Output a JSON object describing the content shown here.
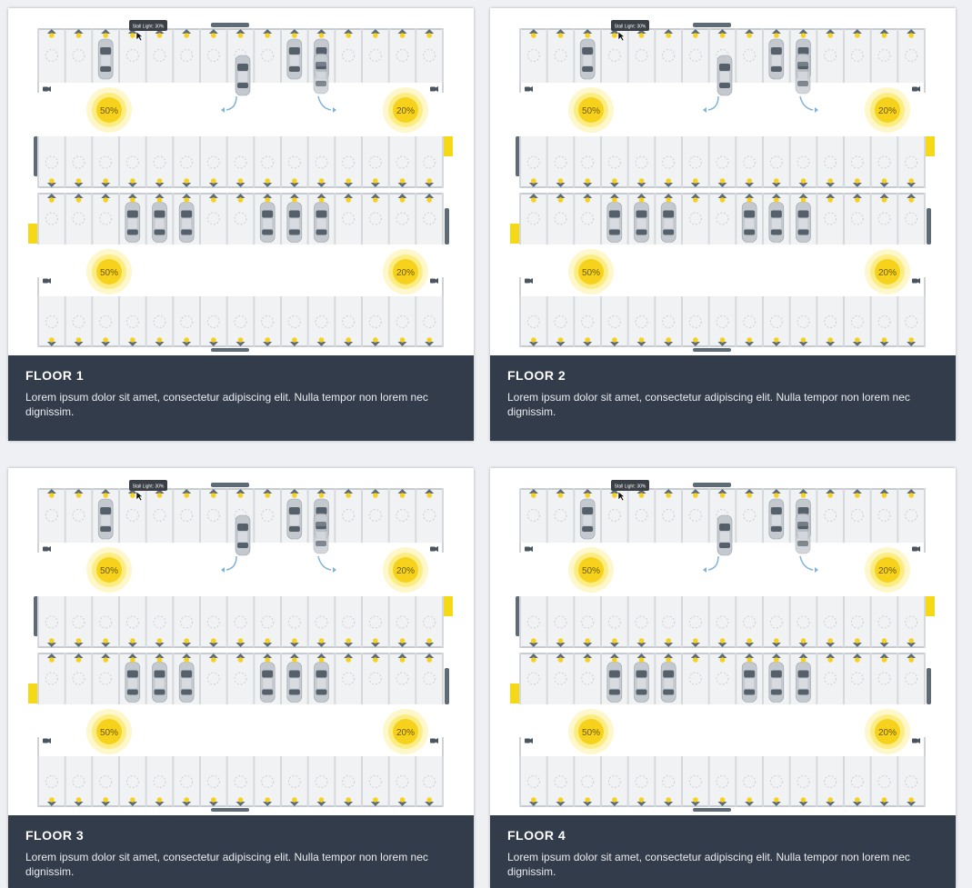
{
  "floors": [
    {
      "title": "FLOOR 1",
      "description": "Lorem ipsum dolor sit amet, consectetur adipiscing elit. Nulla tempor non lorem nec dignissim.",
      "tooltip": "Stall Light: 30%",
      "lights": [
        "50%",
        "20%",
        "50%",
        "20%"
      ]
    },
    {
      "title": "FLOOR 2",
      "description": "Lorem ipsum dolor sit amet, consectetur adipiscing elit. Nulla tempor non lorem nec dignissim.",
      "tooltip": "Stall Light: 30%",
      "lights": [
        "50%",
        "20%",
        "50%",
        "20%"
      ]
    },
    {
      "title": "FLOOR 3",
      "description": "Lorem ipsum dolor sit amet, consectetur adipiscing elit. Nulla tempor non lorem nec dignissim.",
      "tooltip": "Stall Light: 30%",
      "lights": [
        "50%",
        "20%",
        "50%",
        "20%"
      ]
    },
    {
      "title": "FLOOR 4",
      "description": "Lorem ipsum dolor sit amet, consectetur adipiscing elit. Nulla tempor non lorem nec dignissim.",
      "tooltip": "Stall Light: 30%",
      "lights": [
        "50%",
        "20%",
        "50%",
        "20%"
      ]
    }
  ],
  "colors": {
    "caption_bg": "#333c4a",
    "stall_light": "#f7d21c",
    "light_glow": "#fbe96a",
    "car_body": "#c4c9cf",
    "car_glass": "#55606b",
    "lane_floor": "#f1f2f4",
    "wall": "#5e6a75",
    "exit_marker": "#f5d816"
  },
  "icons": [
    "stall-lamp-icon",
    "light-zone-icon",
    "car-icon",
    "camera-icon",
    "turn-arrow-icon"
  ]
}
